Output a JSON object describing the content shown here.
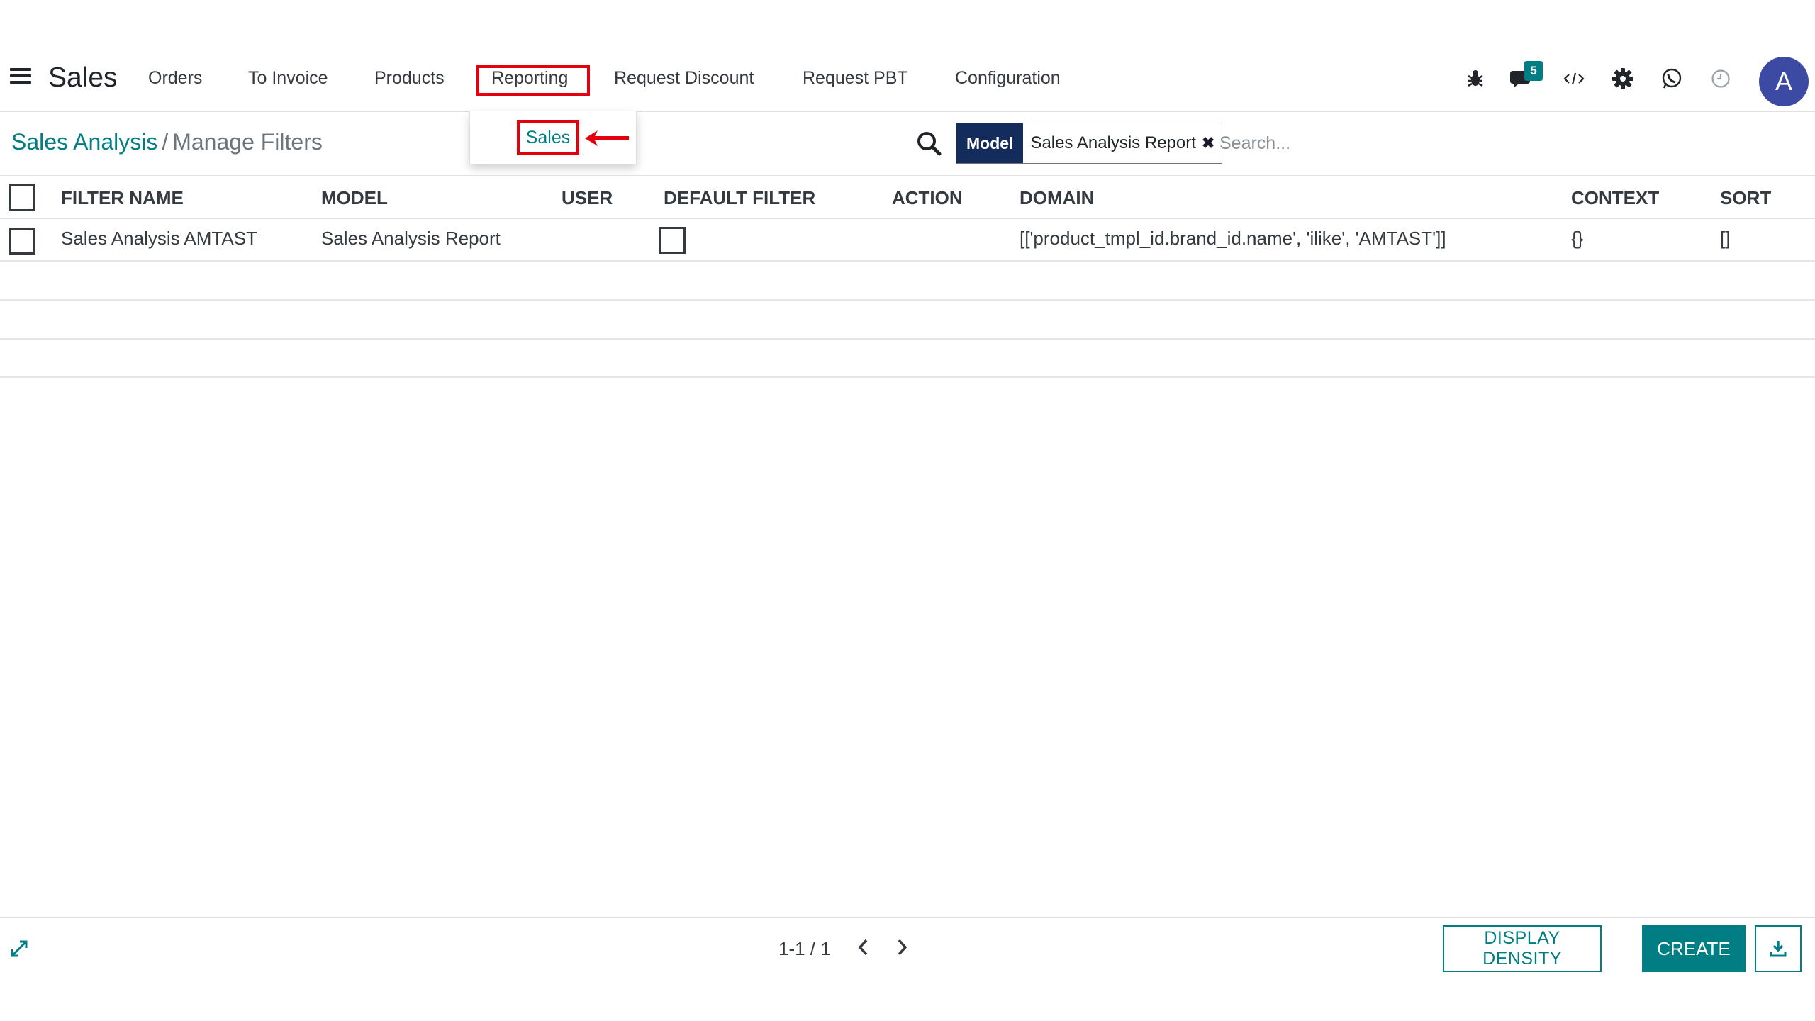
{
  "app": {
    "name": "Sales"
  },
  "menu": {
    "items": [
      "Orders",
      "To Invoice",
      "Products",
      "Reporting",
      "Request Discount",
      "Request PBT",
      "Configuration"
    ],
    "active_item": "Reporting"
  },
  "systray": {
    "icons": [
      "bug-icon",
      "chat-icon",
      "code-icon",
      "gear-icon",
      "whatsapp-icon",
      "clock-icon"
    ],
    "messages_badge": "5",
    "avatar_initial": "A"
  },
  "dropdown": {
    "item_label": "Sales"
  },
  "breadcrumb": {
    "parent": "Sales Analysis",
    "separator": "/",
    "current": "Manage Filters"
  },
  "search": {
    "facet_label": "Model",
    "facet_value": "Sales Analysis Report",
    "placeholder": "Search..."
  },
  "table": {
    "columns": [
      "FILTER NAME",
      "MODEL",
      "USER",
      "DEFAULT FILTER",
      "ACTION",
      "DOMAIN",
      "CONTEXT",
      "SORT"
    ],
    "rows": [
      {
        "filter_name": "Sales Analysis AMTAST",
        "model": "Sales Analysis Report",
        "user": "",
        "default_filter": false,
        "action": "",
        "domain": "[['product_tmpl_id.brand_id.name', 'ilike', 'AMTAST']]",
        "context": "{}",
        "sort": "[]"
      }
    ]
  },
  "footer": {
    "pager": "1-1 / 1",
    "display_density_label": "DISPLAY DENSITY",
    "create_label": "CREATE"
  },
  "colors": {
    "accent": "#017e84",
    "highlight": "#e3000f",
    "facet_label_bg": "#132c5c",
    "avatar_bg": "#3c4aa4"
  }
}
